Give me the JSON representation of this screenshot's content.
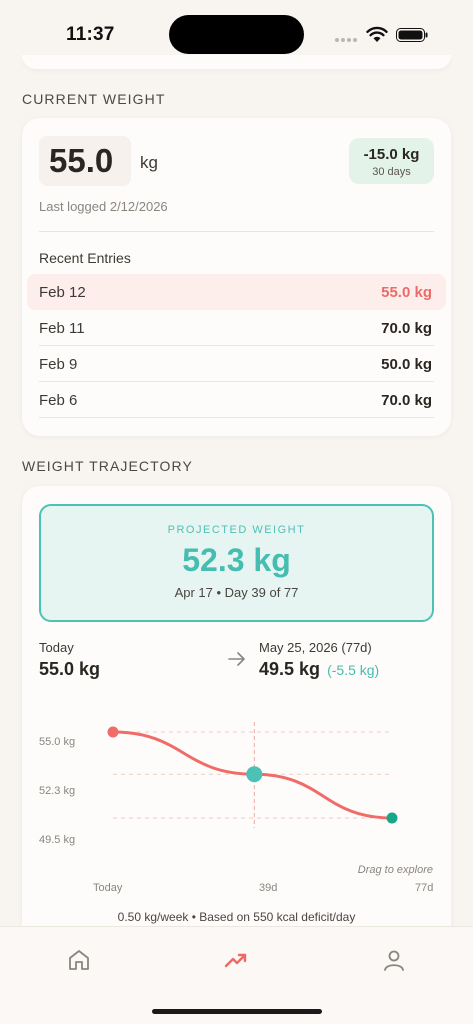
{
  "status_bar": {
    "time": "11:37"
  },
  "current_weight": {
    "section_label": "CURRENT WEIGHT",
    "value": "55.0",
    "unit": "kg",
    "change": {
      "value": "-15.0 kg",
      "period": "30 days"
    },
    "last_logged": "Last logged 2/12/2026",
    "recent_title": "Recent Entries",
    "entries": [
      {
        "date": "Feb 12",
        "value": "55.0 kg"
      },
      {
        "date": "Feb 11",
        "value": "70.0 kg"
      },
      {
        "date": "Feb 9",
        "value": "50.0 kg"
      },
      {
        "date": "Feb 6",
        "value": "70.0 kg"
      }
    ]
  },
  "trajectory": {
    "section_label": "WEIGHT TRAJECTORY",
    "projected": {
      "label": "PROJECTED WEIGHT",
      "value": "52.3 kg",
      "subtitle": "Apr 17 • Day 39 of 77"
    },
    "today": {
      "label": "Today",
      "value": "55.0 kg"
    },
    "target": {
      "date": "May 25, 2026 (77d)",
      "value": "49.5 kg",
      "diff": "(-5.5 kg)"
    },
    "drag_hint": "Drag to explore",
    "footnote": "0.50 kg/week • Based on 550 kcal deficit/day"
  },
  "chart_data": {
    "type": "line",
    "x": [
      0,
      39,
      77
    ],
    "series": [
      {
        "values": [
          55.0,
          52.3,
          49.5
        ]
      }
    ],
    "y_ticks": [
      "55.0 kg",
      "52.3 kg",
      "49.5 kg"
    ],
    "x_ticks": [
      "Today",
      "39d",
      "77d"
    ],
    "selected_x": 39,
    "colors": {
      "line": "#f06c68",
      "start_point": "#f06c68",
      "selected_point": "#4ec1b5",
      "end_point": "#1aa68a"
    }
  },
  "tab_bar": {
    "tabs": [
      "home-icon",
      "trend-icon",
      "profile-icon"
    ],
    "active": 1
  },
  "colors": {
    "accent_teal": "#4ec1b5",
    "accent_red": "#ec6b68",
    "background": "#f8f5f1"
  }
}
